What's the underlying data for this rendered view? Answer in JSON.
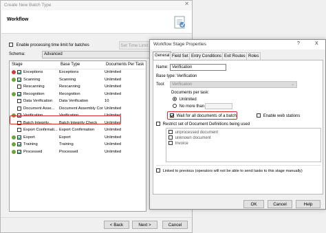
{
  "dialog1": {
    "title": "Create New Batch Type",
    "header": "Workflow",
    "enable_time_limit": "Enable processing time limit for batches",
    "set_time_limit": "Set Time Limit...",
    "schema_label": "Schema:",
    "schema_value": "Advanced",
    "columns": [
      "Stage",
      "Base Type",
      "Documents Per Task"
    ],
    "rows": [
      {
        "stage": "Exceptions",
        "base": "Exceptions",
        "docs": "Unlimited"
      },
      {
        "stage": "Scanning",
        "base": "Scanning",
        "docs": "Unlimited"
      },
      {
        "stage": "Rescanning",
        "base": "Rescanning",
        "docs": "Unlimited"
      },
      {
        "stage": "Recognition",
        "base": "Recognition",
        "docs": "Unlimited"
      },
      {
        "stage": "Data Verification",
        "base": "Data Verification",
        "docs": "10"
      },
      {
        "stage": "Document Asse...",
        "base": "Document Assembly Cor...",
        "docs": "Unlimited"
      },
      {
        "stage": "Verification",
        "base": "Verification",
        "docs": "Unlimited"
      },
      {
        "stage": "Batch Integrity...",
        "base": "Batch Integrity Check",
        "docs": "Unlimited"
      },
      {
        "stage": "Export Confirmati...",
        "base": "Export Confirmation",
        "docs": "Unlimited"
      },
      {
        "stage": "Export",
        "base": "Export",
        "docs": "Unlimited"
      },
      {
        "stage": "Training",
        "base": "Training",
        "docs": "Unlimited"
      },
      {
        "stage": "Processed",
        "base": "Processed",
        "docs": "Unlimited"
      }
    ],
    "back": "< Back",
    "next": "Next >",
    "cancel": "Cancel"
  },
  "dialog2": {
    "title": "Workflow Stage Properties",
    "help": "?",
    "close": "X",
    "tabs": [
      "General",
      "Field Set",
      "Entry Conditions",
      "Exit Routes",
      "Roles"
    ],
    "name_label": "Name:",
    "name_value": "Verification",
    "base_type": "Base type: Verification",
    "tool_label": "Tool:",
    "tool_value": "Verification",
    "docs_per_task": "Documents per task:",
    "unlimited": "Unlimited",
    "no_more_than": "No more than",
    "wait_all": "Wait for all documents of a batch",
    "enable_web": "Enable web stations",
    "restrict": "Restrict set of Document Definitions being used",
    "doc_defs": [
      "unprocessed document",
      "unknown document",
      "Invoice"
    ],
    "linked": "Linked to previous (operators will not be able to send tasks to this stage manually)",
    "ok": "OK",
    "cancel": "Cancel",
    "help_btn": "Help"
  }
}
